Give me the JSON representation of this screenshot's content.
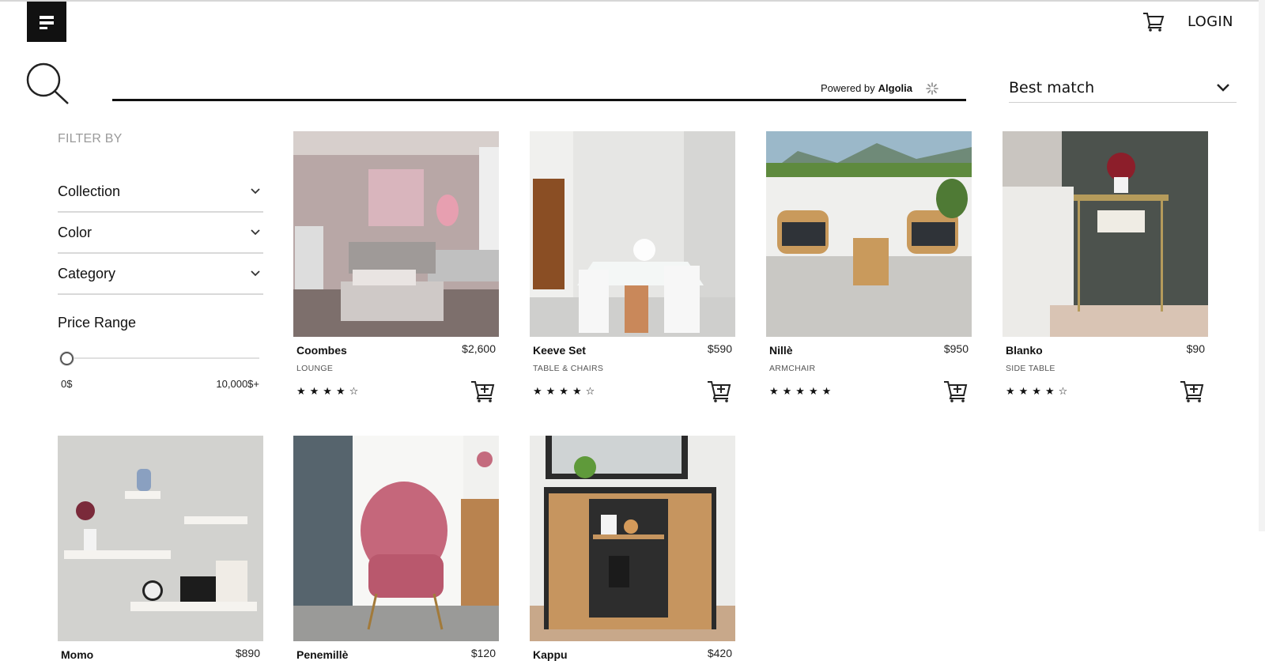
{
  "header": {
    "login_label": "LOGIN"
  },
  "search": {
    "value": "",
    "placeholder": "",
    "powered_by_prefix": "Powered by",
    "powered_by_brand": "Algolia"
  },
  "sort": {
    "selected": "Best match"
  },
  "filters": {
    "title": "FILTER BY",
    "groups": [
      {
        "label": "Collection"
      },
      {
        "label": "Color"
      },
      {
        "label": "Category"
      }
    ],
    "price_range": {
      "title": "Price Range",
      "min_label": "0$",
      "max_label": "10,000$+",
      "value": 0
    }
  },
  "products": [
    {
      "name": "Coombes",
      "price": "$2,600",
      "category": "LOUNGE",
      "rating": 4,
      "stars": "★★★★☆"
    },
    {
      "name": "Keeve Set",
      "price": "$590",
      "category": "TABLE & CHAIRS",
      "rating": 4,
      "stars": "★★★★☆"
    },
    {
      "name": "Nillè",
      "price": "$950",
      "category": "ARMCHAIR",
      "rating": 5,
      "stars": "★★★★★"
    },
    {
      "name": "Blanko",
      "price": "$90",
      "category": "SIDE TABLE",
      "rating": 4,
      "stars": "★★★★☆"
    },
    {
      "name": "Momo",
      "price": "$890"
    },
    {
      "name": "Penemillè",
      "price": "$120"
    },
    {
      "name": "Kappu",
      "price": "$420"
    }
  ],
  "icons": {
    "menu": "menu-icon",
    "cart": "cart-icon",
    "search": "search-icon",
    "algolia": "algolia-icon",
    "sort_toggle": "chevron-down-icon",
    "add_to_cart": "add-to-cart-icon"
  }
}
